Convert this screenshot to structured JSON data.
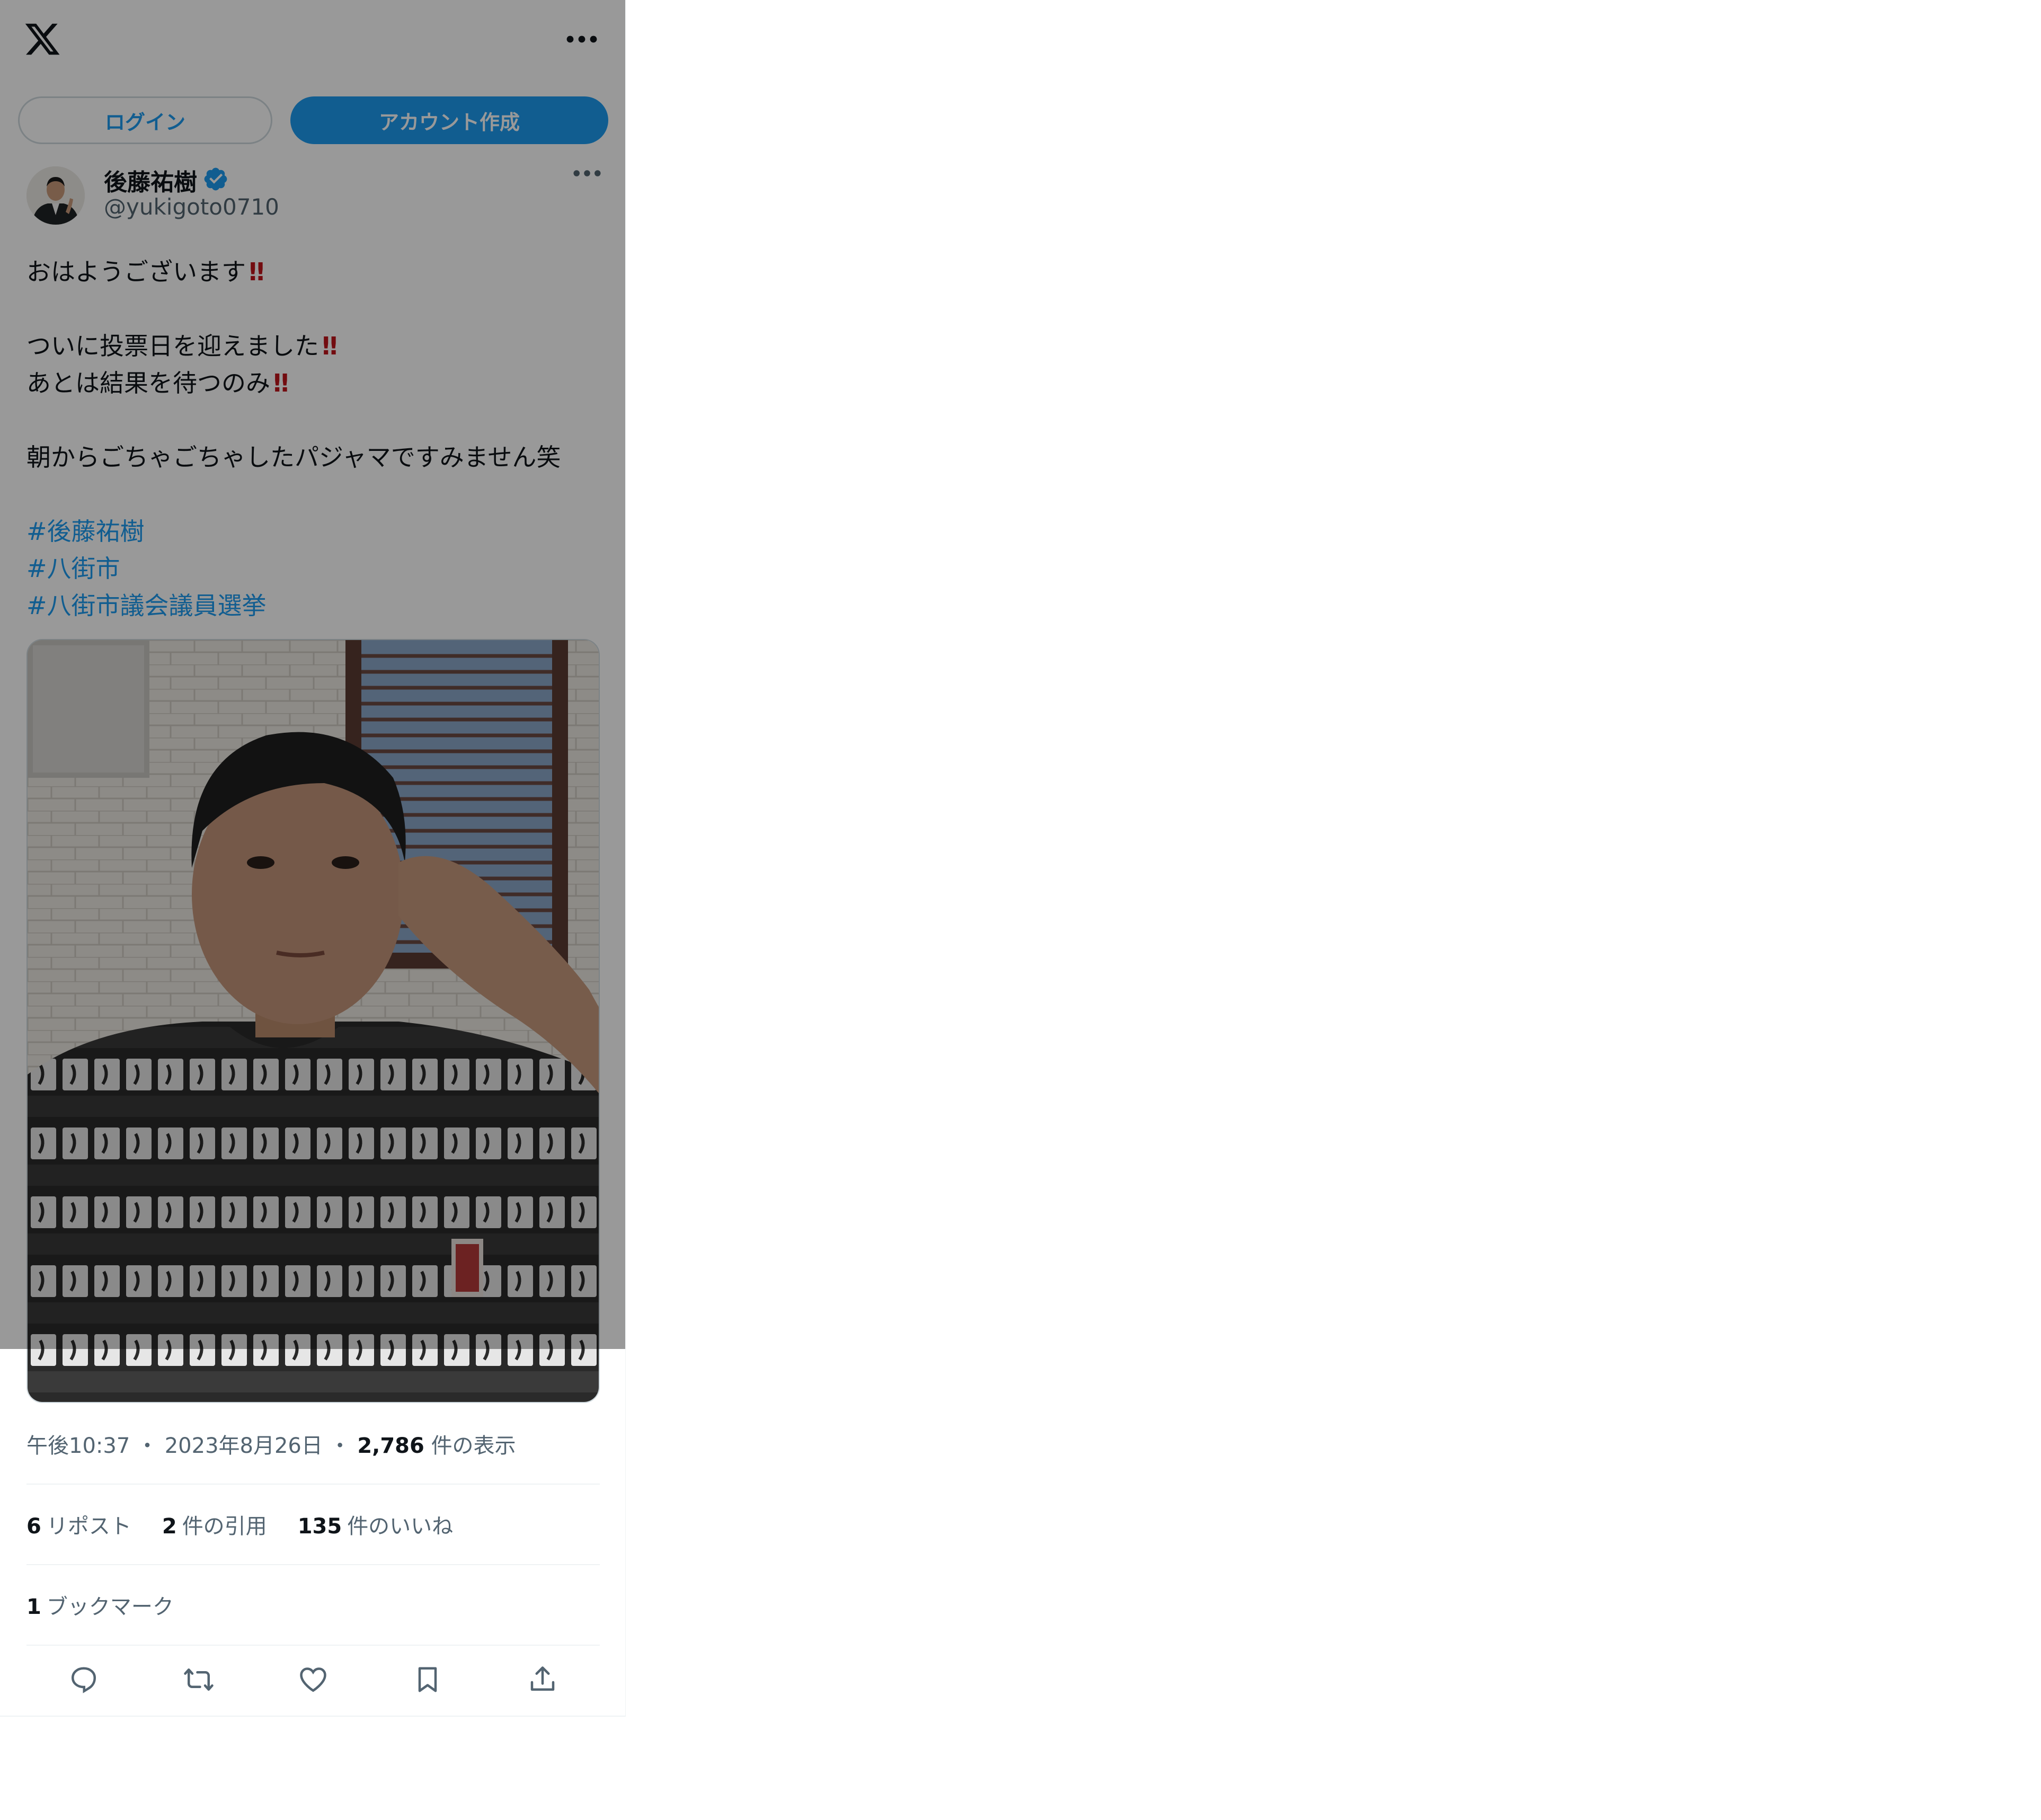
{
  "auth": {
    "login_label": "ログイン",
    "signup_label": "アカウント作成"
  },
  "author": {
    "name": "後藤祐樹",
    "handle": "@yukigoto0710",
    "verified_icon": "verified-badge-icon"
  },
  "tweet": {
    "lines": [
      "おはようございます",
      "",
      "ついに投票日を迎えました",
      "あとは結果を待つのみ",
      "",
      "朝からごちゃごちゃしたパジャマですみません笑",
      ""
    ],
    "emphasis": "‼",
    "hashtags": [
      "#後藤祐樹",
      "#八街市",
      "#八街市議会議員選挙"
    ]
  },
  "meta": {
    "time": "午後10:37",
    "sep": "・",
    "date": "2023年8月26日",
    "views_count": "2,786",
    "views_label": "件の表示"
  },
  "stats": {
    "reposts_count": "6",
    "reposts_label": "リポスト",
    "quotes_count": "2",
    "quotes_label": "件の引用",
    "likes_count": "135",
    "likes_label": "件のいいね",
    "bookmarks_count": "1",
    "bookmarks_label": "ブックマーク"
  },
  "icons": {
    "logo": "x-logo-icon",
    "more": "more-horizontal-icon",
    "reply": "reply-icon",
    "repost": "repost-icon",
    "like": "heart-icon",
    "bookmark": "bookmark-icon",
    "share": "share-icon"
  },
  "colors": {
    "accent": "#1d9bf0",
    "text": "#0f1419",
    "secondary": "#536471",
    "emphasis": "#c0141c"
  }
}
